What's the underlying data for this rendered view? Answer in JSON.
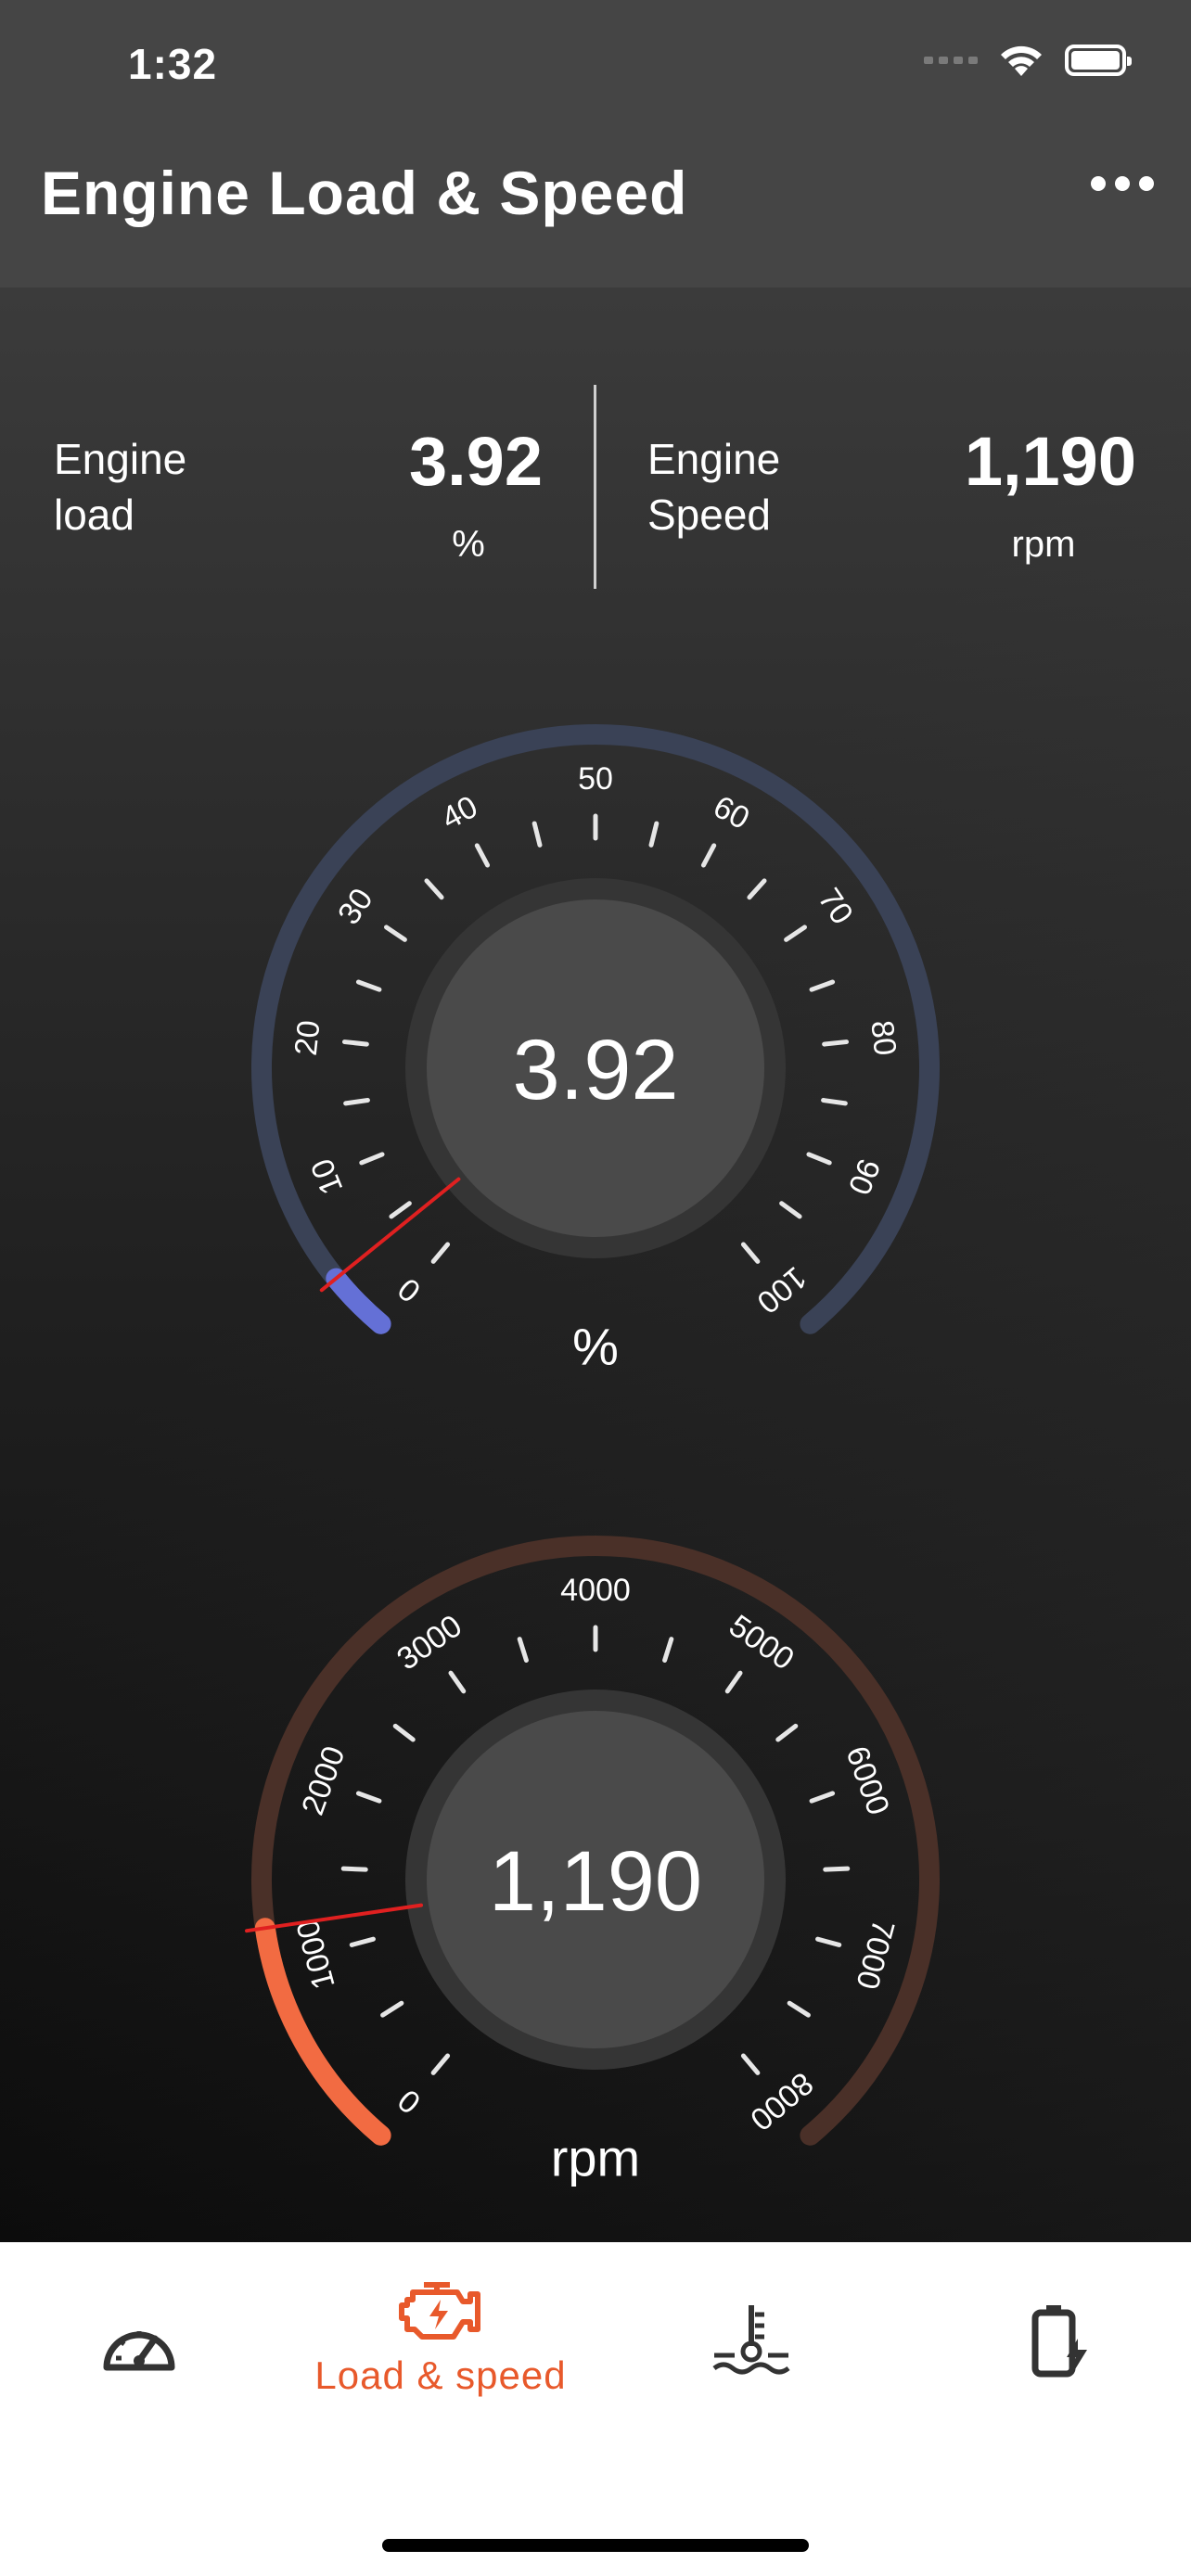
{
  "status_bar": {
    "time": "1:32"
  },
  "header": {
    "title": "Engine Load & Speed",
    "menu_icon": "more-horizontal-icon"
  },
  "summary": {
    "load": {
      "label": "Engine\nload",
      "value": "3.92",
      "unit": "%"
    },
    "speed": {
      "label": "Engine\nSpeed",
      "value": "1,190",
      "unit": "rpm"
    }
  },
  "gauges": {
    "load": {
      "value_text": "3.92",
      "value": 3.92,
      "min": 0,
      "max": 100,
      "unit": "%",
      "ticks": [
        "0",
        "10",
        "20",
        "30",
        "40",
        "50",
        "60",
        "70",
        "80",
        "90",
        "100"
      ],
      "track_color": "#3a4256",
      "active_color": "#6470d6",
      "needle_color": "#e02020"
    },
    "speed": {
      "value_text": "1,190",
      "value": 1190,
      "min": 0,
      "max": 8000,
      "unit": "rpm",
      "ticks": [
        "0",
        "1000",
        "2000",
        "3000",
        "4000",
        "5000",
        "6000",
        "7000",
        "8000"
      ],
      "track_color": "#4a3028",
      "active_color": "#f26b42",
      "needle_color": "#e02020"
    }
  },
  "tabs": [
    {
      "icon": "speedometer-icon",
      "label": "",
      "active": false
    },
    {
      "icon": "engine-icon",
      "label": "Load & speed",
      "active": true
    },
    {
      "icon": "coolant-temperature-icon",
      "label": "",
      "active": false
    },
    {
      "icon": "battery-charging-icon",
      "label": "",
      "active": false
    }
  ],
  "colors": {
    "accent": "#e8592b",
    "tab_inactive": "#333333"
  }
}
